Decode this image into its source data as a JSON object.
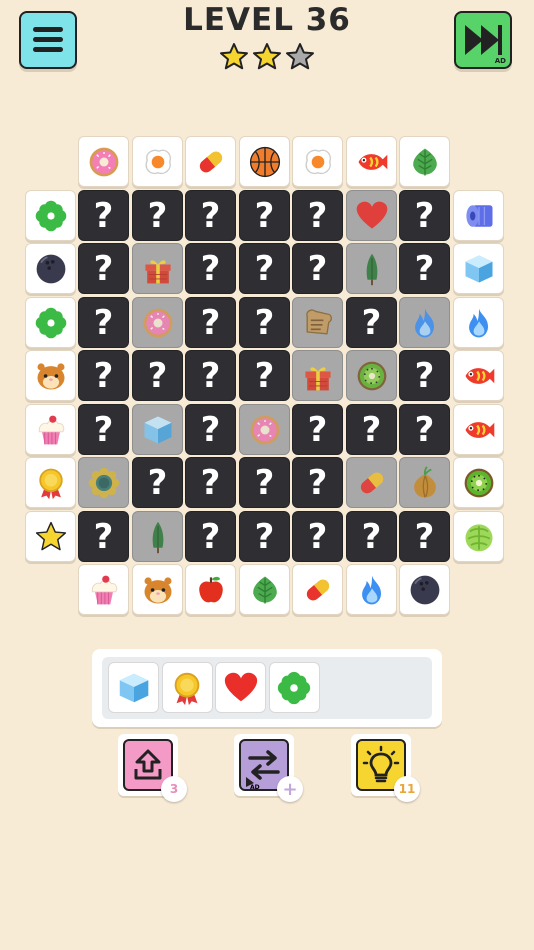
{
  "header": {
    "level_title": "LEVEL 36",
    "stars_earned": 2,
    "stars_total": 3,
    "skip_ad_label": "AD"
  },
  "board": {
    "top_row": [
      "donut",
      "fried-egg",
      "pill",
      "basketball",
      "fried-egg",
      "fish",
      "leaf"
    ],
    "left_column": [
      "clover",
      "bowling-ball",
      "clover",
      "hamster",
      "cupcake",
      "medal",
      "star"
    ],
    "right_column": [
      "toilet-paper",
      "ice-cube",
      "blue-flame",
      "fish",
      "fish",
      "kiwi",
      "lettuce"
    ],
    "bottom_row": [
      "cupcake",
      "hamster",
      "apple",
      "leaf",
      "pill",
      "blue-flame",
      "bowling-ball"
    ],
    "inner_grid": [
      [
        "?",
        "?",
        "?",
        "?",
        "?",
        "heart",
        "?"
      ],
      [
        "?",
        "gift",
        "?",
        "?",
        "?",
        "cypress-tree",
        "?"
      ],
      [
        "?",
        "donut",
        "?",
        "?",
        "toast",
        "?",
        "blue-flame"
      ],
      [
        "?",
        "?",
        "?",
        "?",
        "gift",
        "kiwi",
        "?"
      ],
      [
        "?",
        "ice-cube",
        "?",
        "donut",
        "?",
        "?",
        "?"
      ],
      [
        "sunflower",
        "?",
        "?",
        "?",
        "?",
        "pill",
        "onion"
      ],
      [
        "?",
        "cypress-tree",
        "?",
        "?",
        "?",
        "?",
        "?"
      ]
    ],
    "hidden_symbol": "?"
  },
  "tray": {
    "items": [
      "ice-cube",
      "medal",
      "heart",
      "clover"
    ]
  },
  "powerups": {
    "undo": {
      "count": "3"
    },
    "shuffle": {
      "count": "+",
      "ad_label": "AD"
    },
    "hint": {
      "count": "11"
    }
  },
  "colors": {
    "background": "#f7ebd6",
    "menu_button": "#7fe3ea",
    "skip_button": "#58d36a",
    "hidden_tile": "#2e2e33",
    "undo_button": "#f49ac6",
    "shuffle_button": "#b69fd8",
    "hint_button": "#f7d531",
    "star_filled": "#f7d531",
    "star_empty": "#a9a9a9"
  }
}
